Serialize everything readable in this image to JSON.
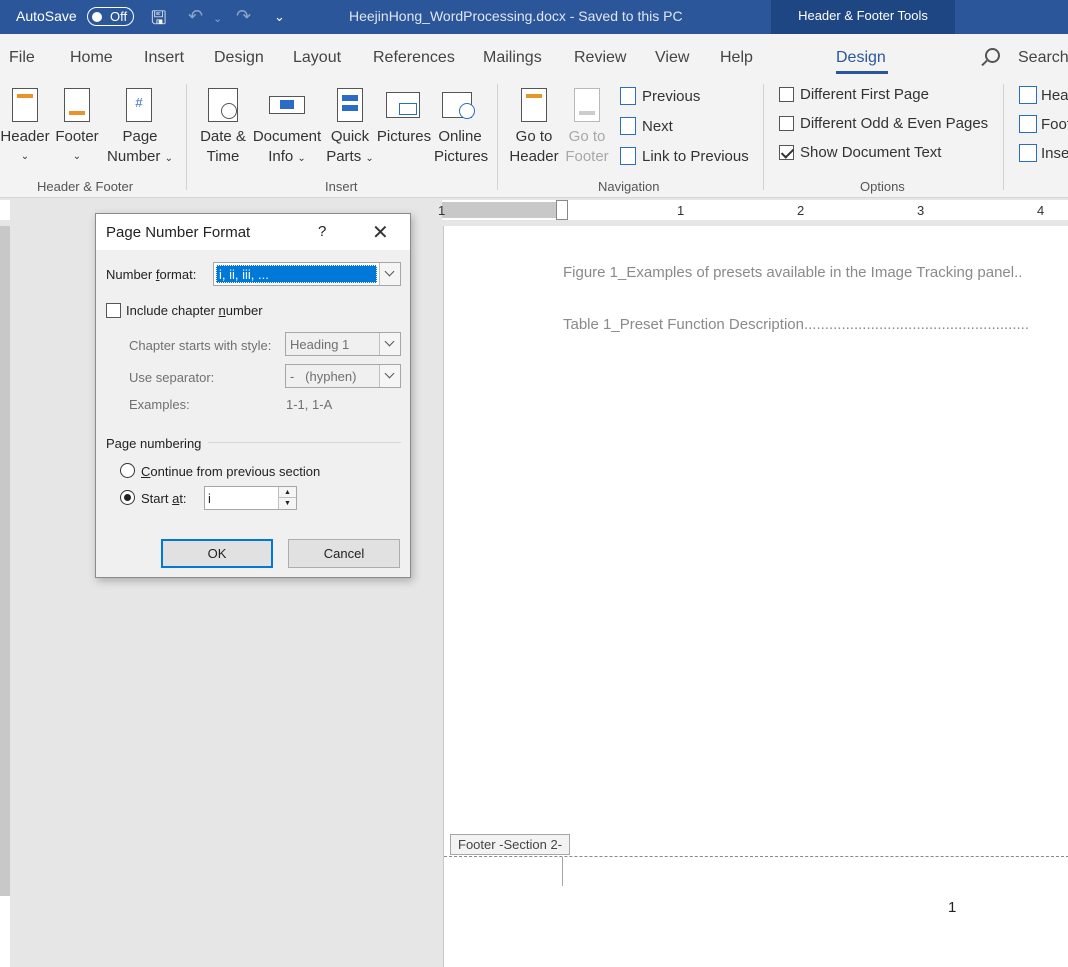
{
  "titlebar": {
    "autosave_label": "AutoSave",
    "autosave_state": "Off",
    "doc_title": "HeejinHong_WordProcessing.docx  -  Saved to this PC",
    "context_tab": "Header & Footer Tools"
  },
  "tabs": {
    "file": "File",
    "home": "Home",
    "insert": "Insert",
    "design": "Design",
    "layout": "Layout",
    "references": "References",
    "mailings": "Mailings",
    "review": "Review",
    "view": "View",
    "help": "Help",
    "design_active": "Design",
    "search": "Search"
  },
  "ribbon": {
    "hf_group": {
      "label": "Header & Footer",
      "header": "Header",
      "footer": "Footer",
      "page": "Page",
      "number": "Number"
    },
    "insert_group": {
      "label": "Insert",
      "date1": "Date &",
      "date2": "Time",
      "doc1": "Document",
      "doc2": "Info",
      "quick1": "Quick",
      "quick2": "Parts",
      "pictures": "Pictures",
      "online1": "Online",
      "online2": "Pictures"
    },
    "nav_group": {
      "label": "Navigation",
      "goto_header1": "Go to",
      "goto_header2": "Header",
      "goto_footer1": "Go to",
      "goto_footer2": "Footer",
      "previous": "Previous",
      "next": "Next",
      "link": "Link to Previous"
    },
    "options_group": {
      "label": "Options",
      "first_page": "Different First Page",
      "odd_even": "Different Odd & Even Pages",
      "show_text": "Show Document Text"
    },
    "position_group": {
      "header_pos": "Hea",
      "footer_pos": "Foot",
      "insert_tab": "Inse"
    }
  },
  "ruler": {
    "n1": "1",
    "n2": "1",
    "n3": "2",
    "n4": "3",
    "n5": "4"
  },
  "document": {
    "toc1": "Figure 1_Examples of presets available in the Image Tracking panel..",
    "toc2": "Table 1_Preset Function Description......................................................",
    "footer_tag": "Footer -Section 2-",
    "page_number": "1"
  },
  "dialog": {
    "title": "Page Number Format",
    "help": "?",
    "number_format_label_pre": "Number ",
    "number_format_label_u": "f",
    "number_format_label_post": "ormat:",
    "number_format_value": "i, ii, iii, ...",
    "include_chapter_pre": "Include chapter ",
    "include_chapter_u": "n",
    "include_chapter_post": "umber",
    "chapter_style_label": "Chapter starts with style:",
    "chapter_style_value": "Heading 1",
    "separator_label": "Use separator:",
    "separator_value": "-   (hyphen)",
    "examples_label": "Examples:",
    "examples_value": "1-1, 1-A",
    "page_numbering_label": "Page numbering",
    "continue_u": "C",
    "continue_post": "ontinue from previous section",
    "start_at_pre": "Start ",
    "start_at_u": "a",
    "start_at_post": "t:",
    "start_at_value": "i",
    "ok": "OK",
    "cancel": "Cancel"
  }
}
